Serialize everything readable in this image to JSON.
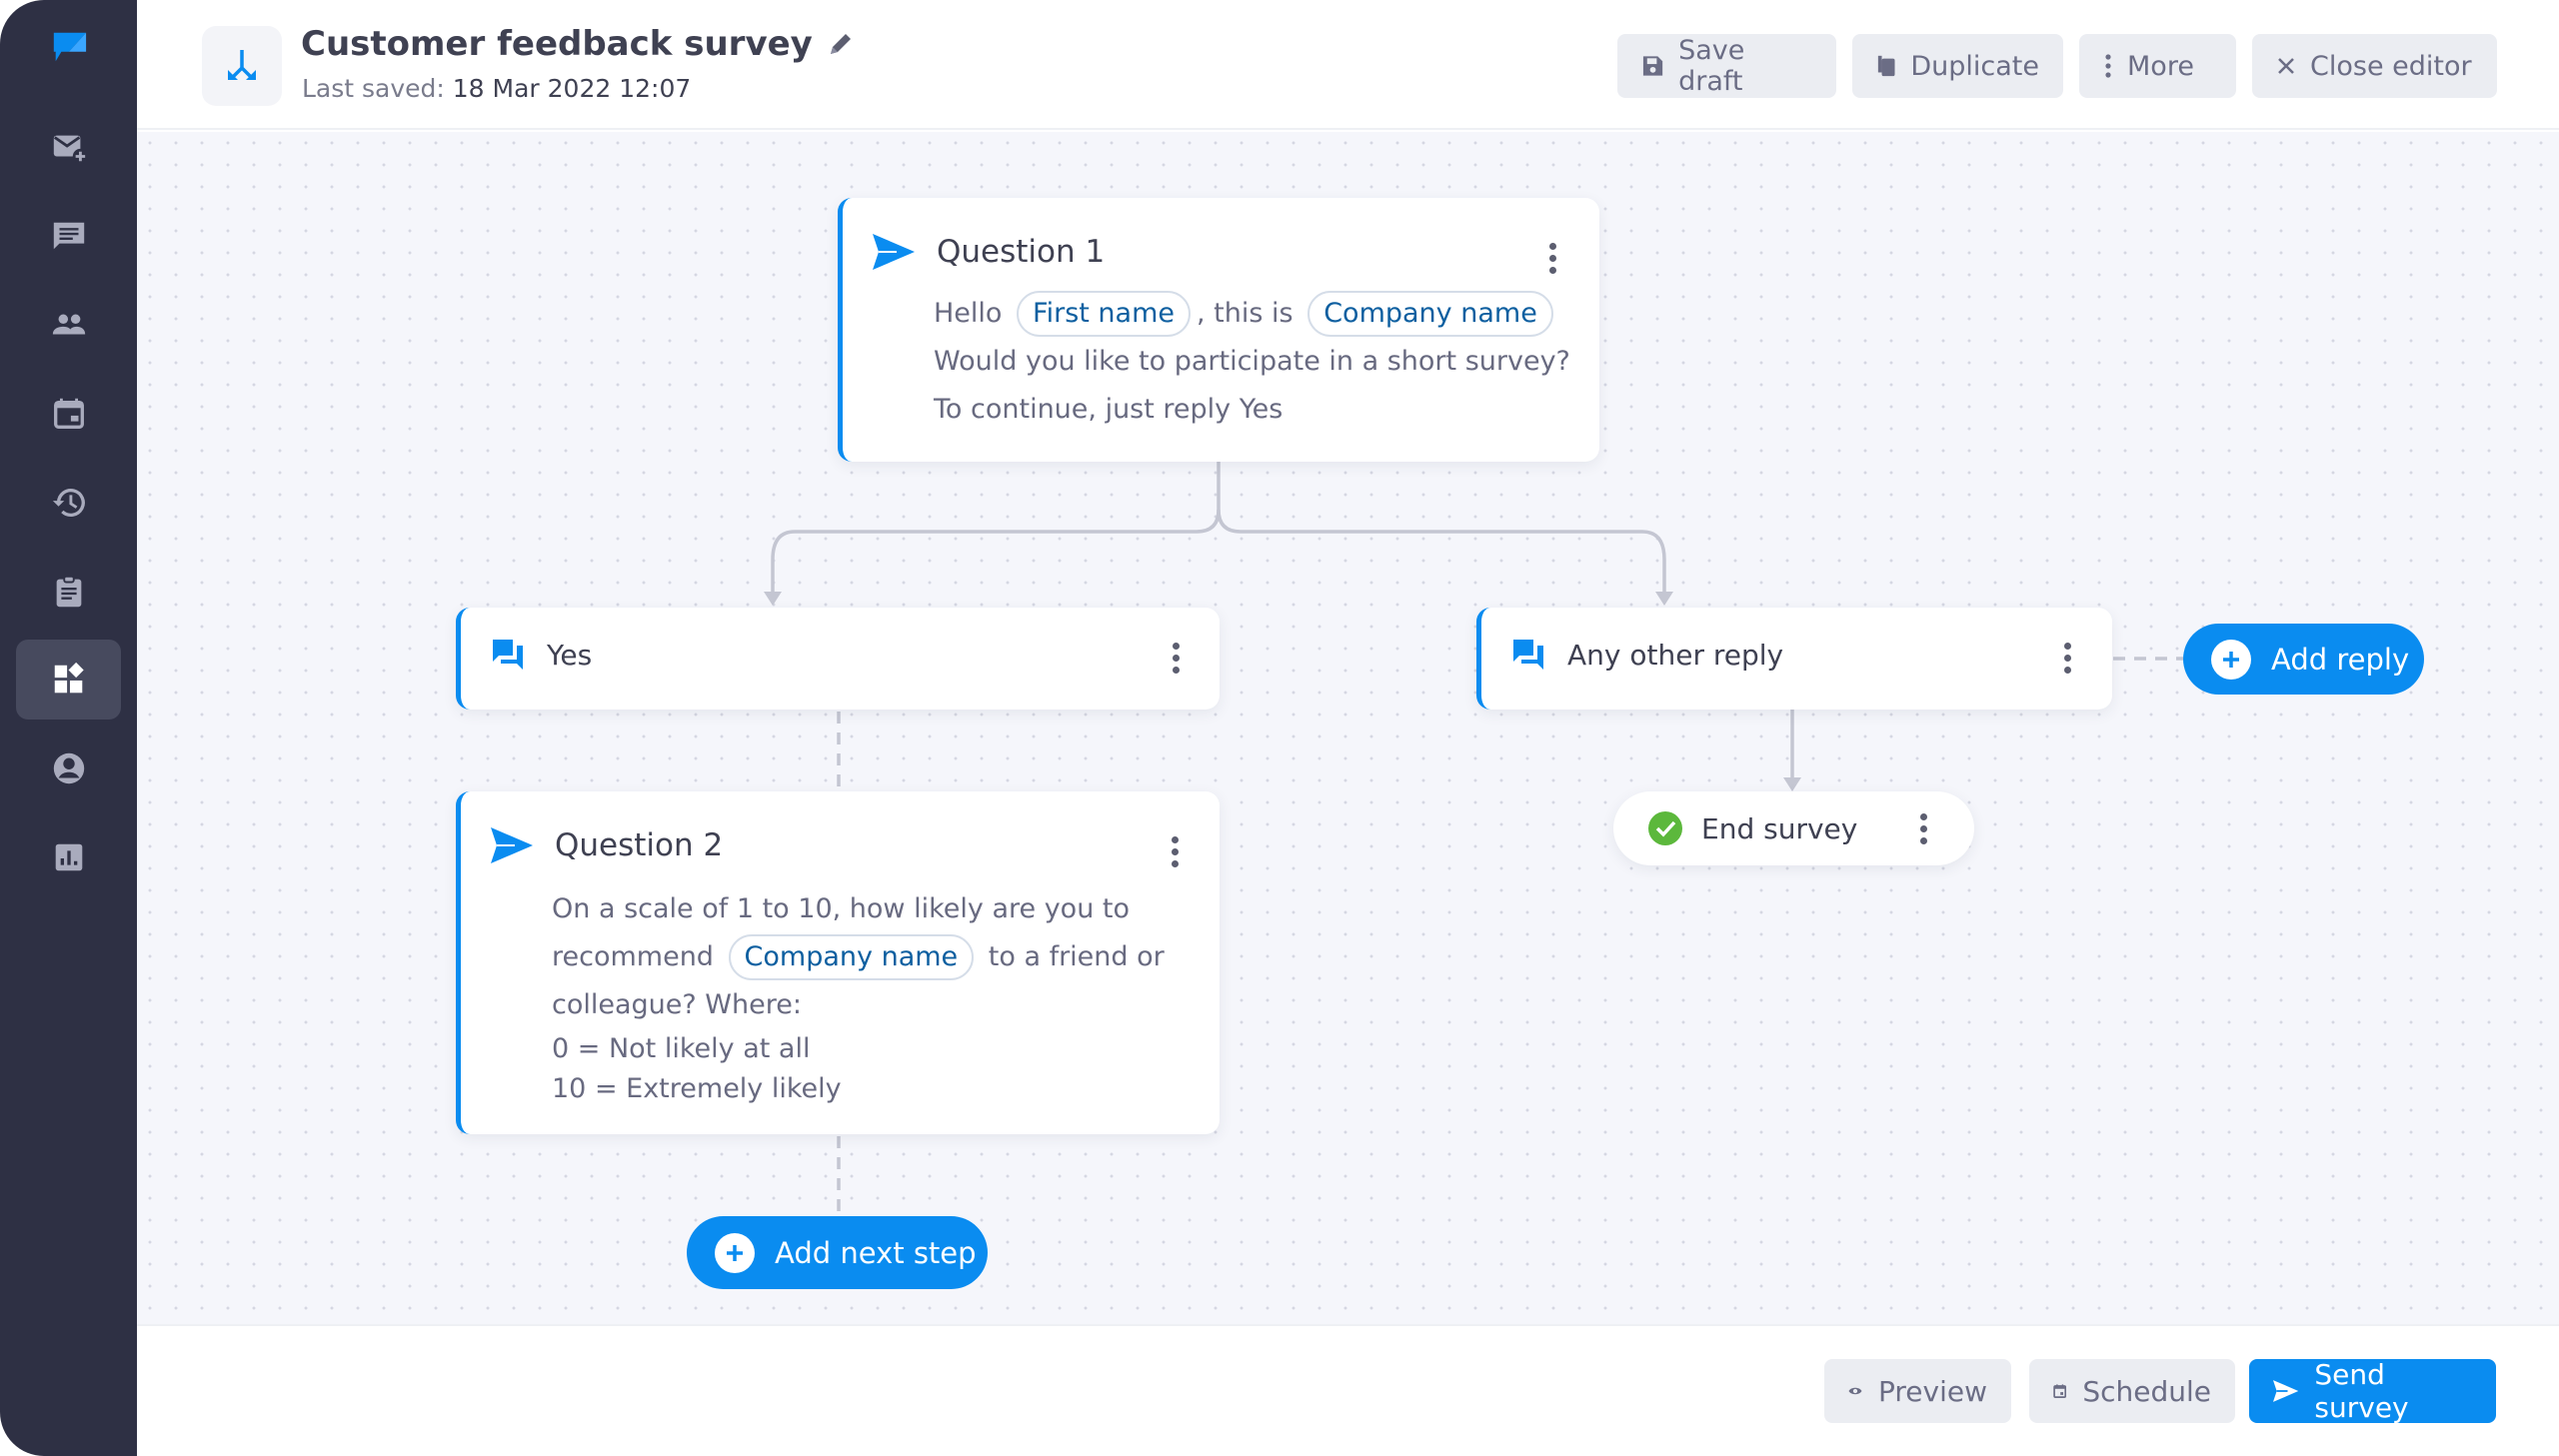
{
  "sidebar": {
    "brand_icon": "brand-chat-flag-icon",
    "items": [
      {
        "icon": "mail-add-icon",
        "active": false
      },
      {
        "icon": "chat-icon",
        "active": false
      },
      {
        "icon": "contacts-icon",
        "active": false
      },
      {
        "icon": "calendar-icon",
        "active": false
      },
      {
        "icon": "history-icon",
        "active": false
      },
      {
        "icon": "clipboard-icon",
        "active": false
      },
      {
        "icon": "apps-icon",
        "active": true
      },
      {
        "icon": "account-icon",
        "active": false
      },
      {
        "icon": "chart-icon",
        "active": false
      }
    ]
  },
  "header": {
    "title": "Customer feedback survey",
    "last_saved_label": "Last saved: ",
    "last_saved_value": "18 Mar 2022 12:07",
    "buttons": {
      "save_draft": "Save draft",
      "duplicate": "Duplicate",
      "more": "More",
      "close_editor": "Close editor"
    }
  },
  "flow": {
    "question1": {
      "title": "Question 1",
      "line1_a": "Hello",
      "chip_first_name": "First name",
      "line1_b": ", this is",
      "chip_company": "Company name",
      "line2": "Would you like to participate in a short survey?",
      "line3": "To continue, just reply Yes"
    },
    "reply_yes": {
      "label": "Yes"
    },
    "reply_other": {
      "label": "Any other reply"
    },
    "add_reply": "Add reply",
    "end_survey": "End survey",
    "question2": {
      "title": "Question 2",
      "line1": "On a scale of 1 to 10, how likely are you to",
      "line2_a": "recommend",
      "chip_company": "Company name",
      "line2_b": "to a friend or",
      "line3": "colleague? Where:",
      "line4": "0 = Not likely at all",
      "line5": "10 = Extremely likely"
    },
    "add_next_step": "Add next step"
  },
  "footer": {
    "preview": "Preview",
    "schedule": "Schedule",
    "send_survey": "Send survey"
  },
  "colors": {
    "accent": "#0a8cf0",
    "sidebar_bg": "#2e3044",
    "success": "#5cb83c"
  }
}
